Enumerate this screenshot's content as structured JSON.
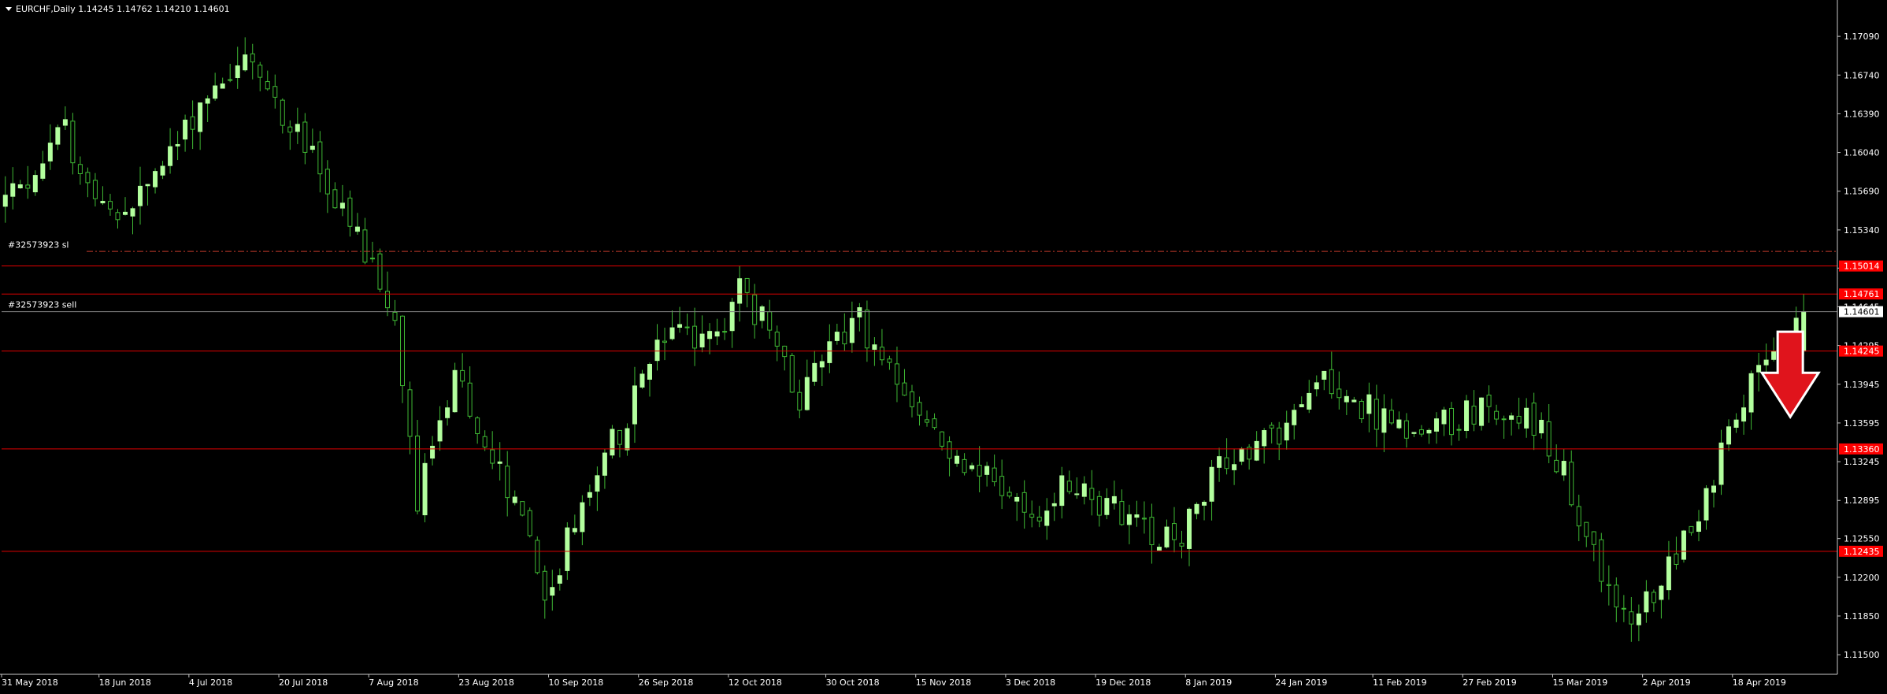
{
  "window": {
    "symbol_line": "EURCHF,Daily  1.14245 1.14762 1.14210 1.14601"
  },
  "colors": {
    "background": "#000000",
    "bull_candle": "#b3ff9e",
    "bear_candle": "#000000",
    "wick": "#3fb934",
    "axis": "#c8c8c8",
    "text": "#ffffff",
    "level_line": "#e00000",
    "level_tag": "#ff0000",
    "arrow_fill": "#e0141c",
    "arrow_stroke": "#ffffff"
  },
  "chart_data": {
    "type": "candlestick",
    "symbol": "EURCHF",
    "timeframe": "Daily",
    "ohlc_header": {
      "open": 1.14245,
      "high": 1.14762,
      "low": 1.1421,
      "close": 1.14601
    },
    "ylim": [
      1.1133,
      1.1739
    ],
    "y_ticks": [
      "1.17090",
      "1.16740",
      "1.16390",
      "1.16040",
      "1.15690",
      "1.15340",
      "1.14995",
      "1.14645",
      "1.14295",
      "1.13945",
      "1.13595",
      "1.13245",
      "1.12895",
      "1.12550",
      "1.12200",
      "1.11850",
      "1.11500"
    ],
    "x_ticks": [
      "31 May 2018",
      "18 Jun 2018",
      "4 Jul 2018",
      "20 Jul 2018",
      "7 Aug 2018",
      "23 Aug 2018",
      "10 Sep 2018",
      "26 Sep 2018",
      "12 Oct 2018",
      "30 Oct 2018",
      "15 Nov 2018",
      "3 Dec 2018",
      "19 Dec 2018",
      "8 Jan 2019",
      "24 Jan 2019",
      "11 Feb 2019",
      "27 Feb 2019",
      "15 Mar 2019",
      "2 Apr 2019",
      "18 Apr 2019"
    ],
    "x_tick_bar_index": [
      0,
      13,
      25,
      37,
      49,
      61,
      73,
      85,
      97,
      110,
      122,
      134,
      146,
      158,
      170,
      183,
      195,
      207,
      219,
      231
    ],
    "visible_bars": 245,
    "current_price": {
      "label": "1.14601",
      "value": 1.14601
    },
    "levels": [
      {
        "label": "1.15014",
        "value": 1.15014
      },
      {
        "label": "1.14761",
        "value": 1.14761
      },
      {
        "label": "1.14245",
        "value": 1.14245
      },
      {
        "label": "1.13360",
        "value": 1.1336
      },
      {
        "label": "1.12435",
        "value": 1.12435
      }
    ],
    "stop_loss_line": {
      "value": 1.15146,
      "style": "dash-dot"
    },
    "orders": [
      {
        "label": "#32573923 sl",
        "value": 1.152
      },
      {
        "label": "#32573923 sell",
        "value": 1.1466
      }
    ],
    "annotation": {
      "type": "arrow-down",
      "near_bar": 238,
      "from_value": 1.1442,
      "to_value": 1.1365
    },
    "close_waypoints": [
      [
        0,
        1.156
      ],
      [
        8,
        1.162
      ],
      [
        14,
        1.154
      ],
      [
        20,
        1.158
      ],
      [
        27,
        1.166
      ],
      [
        32,
        1.169
      ],
      [
        40,
        1.161
      ],
      [
        48,
        1.151
      ],
      [
        52,
        1.145
      ],
      [
        55,
        1.129
      ],
      [
        60,
        1.14
      ],
      [
        65,
        1.133
      ],
      [
        70,
        1.125
      ],
      [
        72,
        1.12
      ],
      [
        78,
        1.13
      ],
      [
        84,
        1.138
      ],
      [
        88,
        1.144
      ],
      [
        94,
        1.143
      ],
      [
        98,
        1.148
      ],
      [
        102,
        1.144
      ],
      [
        106,
        1.138
      ],
      [
        110,
        1.144
      ],
      [
        114,
        1.145
      ],
      [
        118,
        1.14
      ],
      [
        122,
        1.137
      ],
      [
        126,
        1.133
      ],
      [
        130,
        1.132
      ],
      [
        134,
        1.129
      ],
      [
        137,
        1.127
      ],
      [
        142,
        1.131
      ],
      [
        148,
        1.128
      ],
      [
        153,
        1.126
      ],
      [
        157,
        1.126
      ],
      [
        160,
        1.13
      ],
      [
        164,
        1.133
      ],
      [
        168,
        1.134
      ],
      [
        172,
        1.136
      ],
      [
        175,
        1.141
      ],
      [
        180,
        1.138
      ],
      [
        184,
        1.136
      ],
      [
        190,
        1.135
      ],
      [
        195,
        1.137
      ],
      [
        200,
        1.137
      ],
      [
        205,
        1.136
      ],
      [
        208,
        1.131
      ],
      [
        211,
        1.126
      ],
      [
        214,
        1.12
      ],
      [
        217,
        1.1175
      ],
      [
        221,
        1.122
      ],
      [
        225,
        1.127
      ],
      [
        229,
        1.133
      ],
      [
        233,
        1.139
      ],
      [
        237,
        1.1425
      ],
      [
        240,
        1.146
      ]
    ]
  }
}
